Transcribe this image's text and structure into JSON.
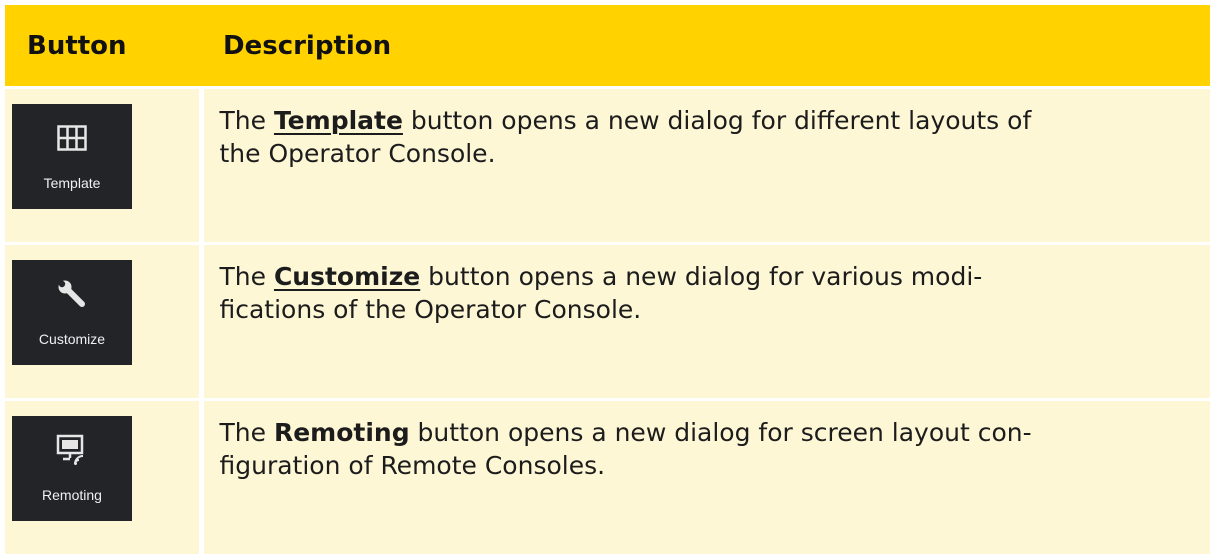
{
  "header": {
    "col1": "Button",
    "col2": "Description"
  },
  "rows": [
    {
      "button_label": "Template",
      "icon": "grid-icon",
      "pre": "The ",
      "keyword": "Template",
      "keyword_is_link": true,
      "post_line1": " button opens a new dialog for different layouts of",
      "line2": "the Operator Console."
    },
    {
      "button_label": "Customize",
      "icon": "wrench-icon",
      "pre": "The ",
      "keyword": "Customize",
      "keyword_is_link": true,
      "post_line1": " button opens a new dialog for various modi-",
      "line2": "fications of the Operator Console."
    },
    {
      "button_label": "Remoting",
      "icon": "remote-screen-icon",
      "pre": "The ",
      "keyword": "Remoting",
      "keyword_is_link": false,
      "post_line1": " button opens a new dialog for screen layout con-",
      "line2": "figuration of Remote Consoles."
    }
  ],
  "colors": {
    "header_bg": "#ffd200",
    "row_bg": "#fdf7d6",
    "button_bg": "#222428"
  }
}
